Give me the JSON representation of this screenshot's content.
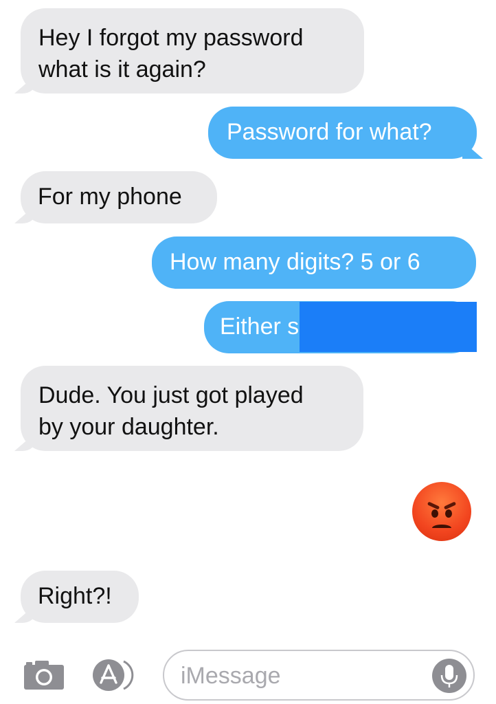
{
  "messages": [
    {
      "direction": "received",
      "lines": [
        "Hey I forgot my password",
        "what is it again?"
      ]
    },
    {
      "direction": "sent",
      "lines": [
        "Password for what?"
      ]
    },
    {
      "direction": "received",
      "lines": [
        "For my phone"
      ]
    },
    {
      "direction": "sent",
      "lines": [
        "How many digits? 5 or 6"
      ]
    },
    {
      "direction": "sent",
      "lines": [
        "Either s"
      ]
    },
    {
      "direction": "received",
      "lines": [
        "Dude. You just got played",
        "by your daughter."
      ]
    },
    {
      "direction": "sent",
      "emoji": "angry-face-emoji"
    },
    {
      "direction": "received",
      "lines": [
        "Right?!"
      ]
    }
  ],
  "composer": {
    "placeholder": "iMessage",
    "camera_icon": "camera-icon",
    "apps_icon": "app-store-icon",
    "mic_icon": "microphone-icon"
  },
  "colors": {
    "sent_bubble": "#4fb3f7",
    "received_bubble": "#e9e9eb",
    "redaction": "#1b7ef8"
  }
}
